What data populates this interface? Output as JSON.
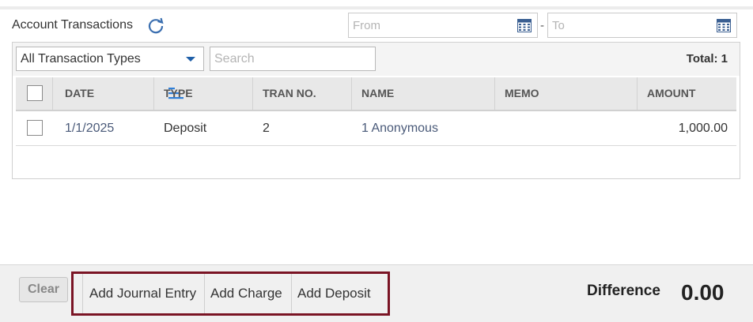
{
  "header": {
    "title": "Account Transactions",
    "refresh_icon": "refresh-icon",
    "from_placeholder": "From",
    "to_placeholder": "To",
    "date_separator": "-",
    "calendar_icon": "calendar-icon"
  },
  "filters": {
    "type_select_value": "All Transaction Types",
    "search_placeholder": "Search",
    "total_label": "Total: 1"
  },
  "table": {
    "columns": [
      "DATE",
      "TYPE",
      "TRAN NO.",
      "NAME",
      "MEMO",
      "AMOUNT"
    ],
    "rows": [
      {
        "date": "1/1/2025",
        "type": "Deposit",
        "tran_no": "2",
        "name": "1 Anonymous",
        "memo": "",
        "amount": "1,000.00"
      }
    ]
  },
  "footer": {
    "clear_label": "Clear",
    "actions": [
      "Add Journal Entry",
      "Add Charge",
      "Add Deposit"
    ],
    "difference_label": "Difference",
    "difference_value": "0.00"
  },
  "colors": {
    "highlight_border": "#7a1424",
    "link_text": "#4a5a79",
    "accent_blue": "#1f5fa8"
  }
}
